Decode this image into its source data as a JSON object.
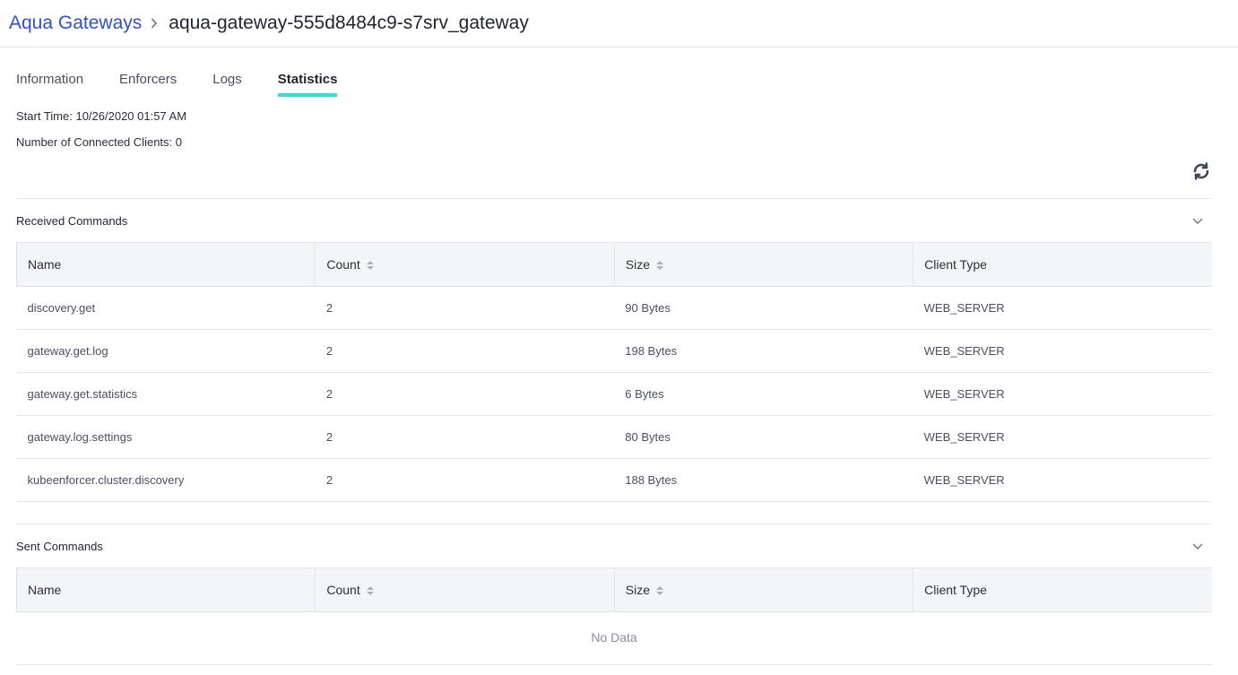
{
  "breadcrumb": {
    "parent": "Aqua Gateways",
    "current": "aqua-gateway-555d8484c9-s7srv_gateway"
  },
  "tabs": [
    {
      "label": "Information",
      "active": false
    },
    {
      "label": "Enforcers",
      "active": false
    },
    {
      "label": "Logs",
      "active": false
    },
    {
      "label": "Statistics",
      "active": true
    }
  ],
  "stats": {
    "start_time": "Start Time: 10/26/2020 01:57 AM",
    "connected_clients": "Number of Connected Clients: 0"
  },
  "icons": {
    "refresh": "refresh-icon",
    "collapse": "chevron-down-icon",
    "sort": "sort-icon"
  },
  "colors": {
    "link": "#2f4fd8",
    "active_tab_underline": "#30e0d2",
    "header_bg": "#f4f5f8"
  },
  "received": {
    "title": "Received Commands",
    "columns": [
      "Name",
      "Count",
      "Size",
      "Client Type"
    ],
    "rows": [
      {
        "name": "discovery.get",
        "count": "2",
        "size": "90 Bytes",
        "client_type": "WEB_SERVER"
      },
      {
        "name": "gateway.get.log",
        "count": "2",
        "size": "198 Bytes",
        "client_type": "WEB_SERVER"
      },
      {
        "name": "gateway.get.statistics",
        "count": "2",
        "size": "6 Bytes",
        "client_type": "WEB_SERVER"
      },
      {
        "name": "gateway.log.settings",
        "count": "2",
        "size": "80 Bytes",
        "client_type": "WEB_SERVER"
      },
      {
        "name": "kubeenforcer.cluster.discovery",
        "count": "2",
        "size": "188 Bytes",
        "client_type": "WEB_SERVER"
      }
    ]
  },
  "sent": {
    "title": "Sent Commands",
    "columns": [
      "Name",
      "Count",
      "Size",
      "Client Type"
    ],
    "empty_text": "No Data"
  }
}
